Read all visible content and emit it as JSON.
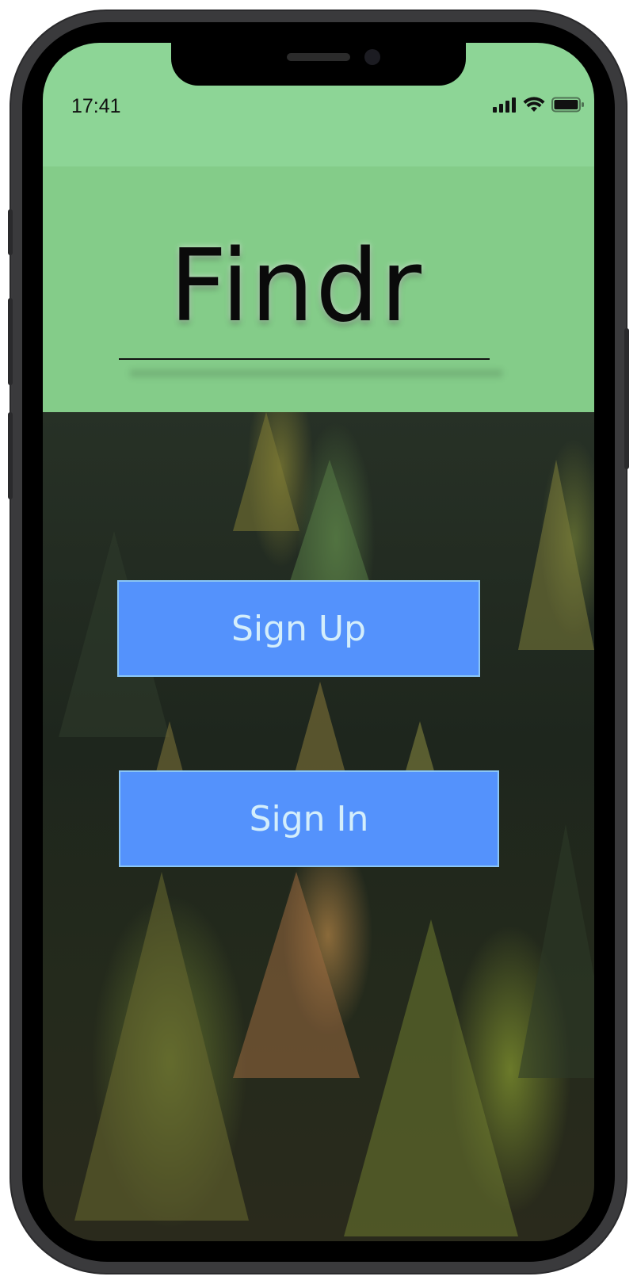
{
  "status_bar": {
    "time": "17:41",
    "icons": [
      "cellular-signal-icon",
      "wifi-icon",
      "battery-icon"
    ]
  },
  "header": {
    "app_title": "Findr"
  },
  "background": {
    "image": "forest-image"
  },
  "actions": {
    "sign_up_label": "Sign Up",
    "sign_in_label": "Sign In"
  },
  "colors": {
    "status_bar_bg": "#8dd596",
    "header_bg": "#84cc89",
    "button_bg": "#5492fc",
    "button_border": "#8bc6f5",
    "button_text": "#d4eefb",
    "title_text": "#0a0a0a"
  }
}
